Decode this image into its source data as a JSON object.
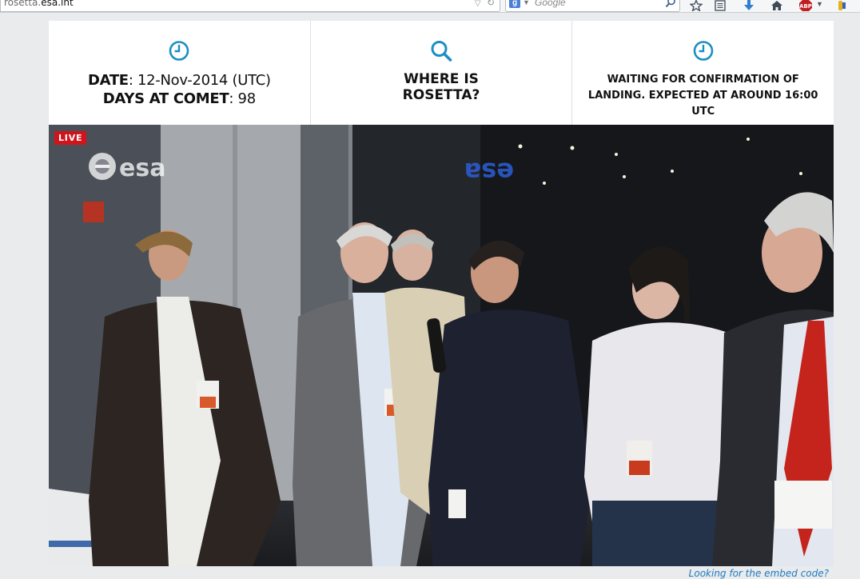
{
  "browser": {
    "url_prefix": "rosetta.",
    "url_domain": "esa.int",
    "search_placeholder": "Google",
    "toolbar_icons": [
      "dropdown-icon",
      "reload-icon",
      "search-engine-icon",
      "bookmark-star-icon",
      "bookmarks-list-icon",
      "download-icon",
      "home-icon",
      "adblock-icon",
      "extension-icon"
    ]
  },
  "info": {
    "date_label": "DATE",
    "date_value": ": 12-Nov-2014 (UTC)",
    "days_label": "DAYS AT COMET",
    "days_value": ": 98",
    "where_line1": "WHERE IS",
    "where_line2": "ROSETTA?",
    "status_line1": "WAITING FOR CONFIRMATION OF",
    "status_line2": "LANDING. EXPECTED AT AROUND 16:00 UTC",
    "accent_color": "#1b8fc4"
  },
  "video": {
    "live_badge": "LIVE",
    "logo_text": "esa",
    "wall_logo_text": "esa",
    "scene_description_icons": [
      "clock-icon",
      "search-icon"
    ]
  },
  "footer": {
    "embed_link": "Looking for the embed code?"
  }
}
